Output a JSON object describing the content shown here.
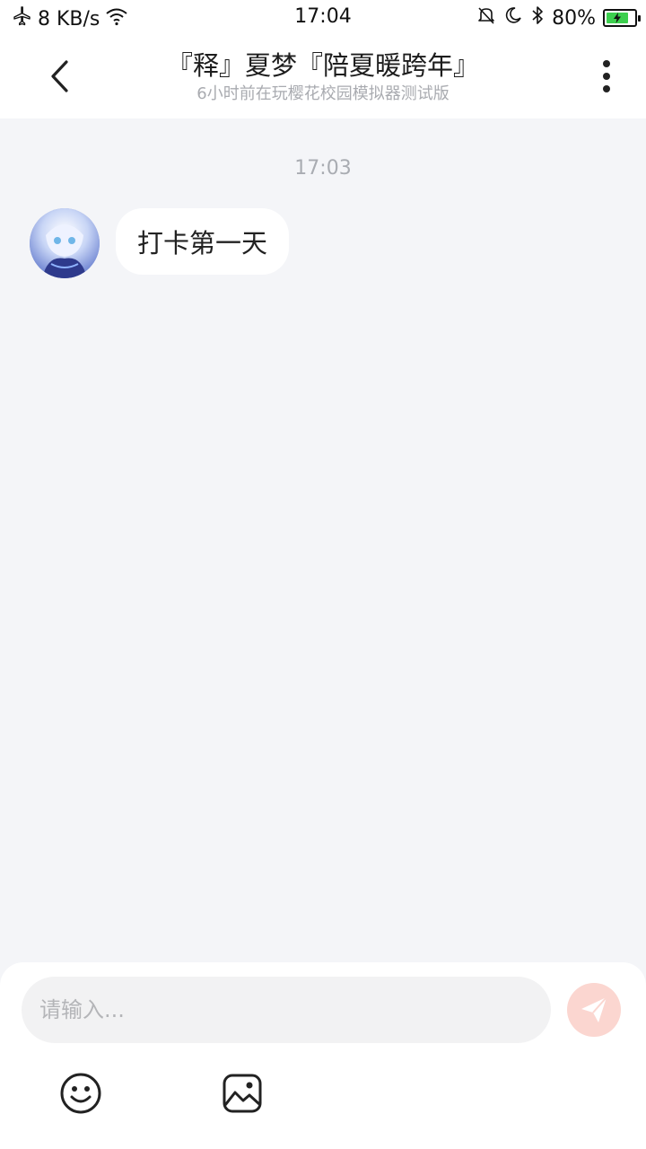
{
  "status_bar": {
    "network_speed": "8 KB/s",
    "time": "17:04",
    "battery_percent": "80%",
    "battery_level": 0.8,
    "icons": [
      "airplane-icon",
      "wifi-icon",
      "mute-icon",
      "moon-icon",
      "bluetooth-icon",
      "battery-icon"
    ]
  },
  "header": {
    "title": "『释』夏梦『陪夏暖跨年』",
    "subtitle": "6小时前在玩樱花校园模拟器测试版"
  },
  "chat": {
    "messages": [
      {
        "timestamp": "17:03",
        "text": "打卡第一天",
        "sender": "other"
      }
    ]
  },
  "composer": {
    "placeholder": "请输入...",
    "value": ""
  },
  "colors": {
    "background": "#f4f5f8",
    "send_button": "#fbd6d0",
    "battery_fill": "#3ccf4e"
  }
}
